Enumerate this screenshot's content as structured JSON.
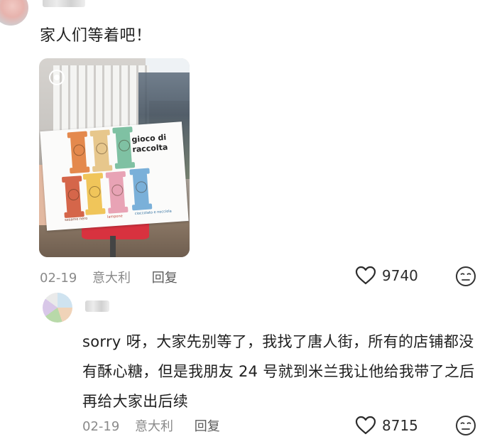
{
  "top_comment": {
    "text": "家人们等着吧！",
    "date": "02-19",
    "location": "意大利",
    "reply_label": "回复",
    "likes": "9740",
    "photo": {
      "sheet_title_line1": "gioco di",
      "sheet_title_line2": "raccolta",
      "caption_left": "sesamo nero",
      "caption_mid": "lampone",
      "caption_right": "cioccolato e nocciola"
    }
  },
  "reply_comment": {
    "text": "sorry 呀，大家先别等了，我找了唐人街，所有的店铺都没有酥心糖，但是我朋友 24 号就到米兰我让他给我带了之后再给大家出后续",
    "date": "02-19",
    "location": "意大利",
    "reply_label": "回复",
    "likes": "8715"
  },
  "icons": {
    "like": "heart-outline-icon",
    "dislike": "meh-face-icon",
    "camera": "live-photo-icon"
  }
}
